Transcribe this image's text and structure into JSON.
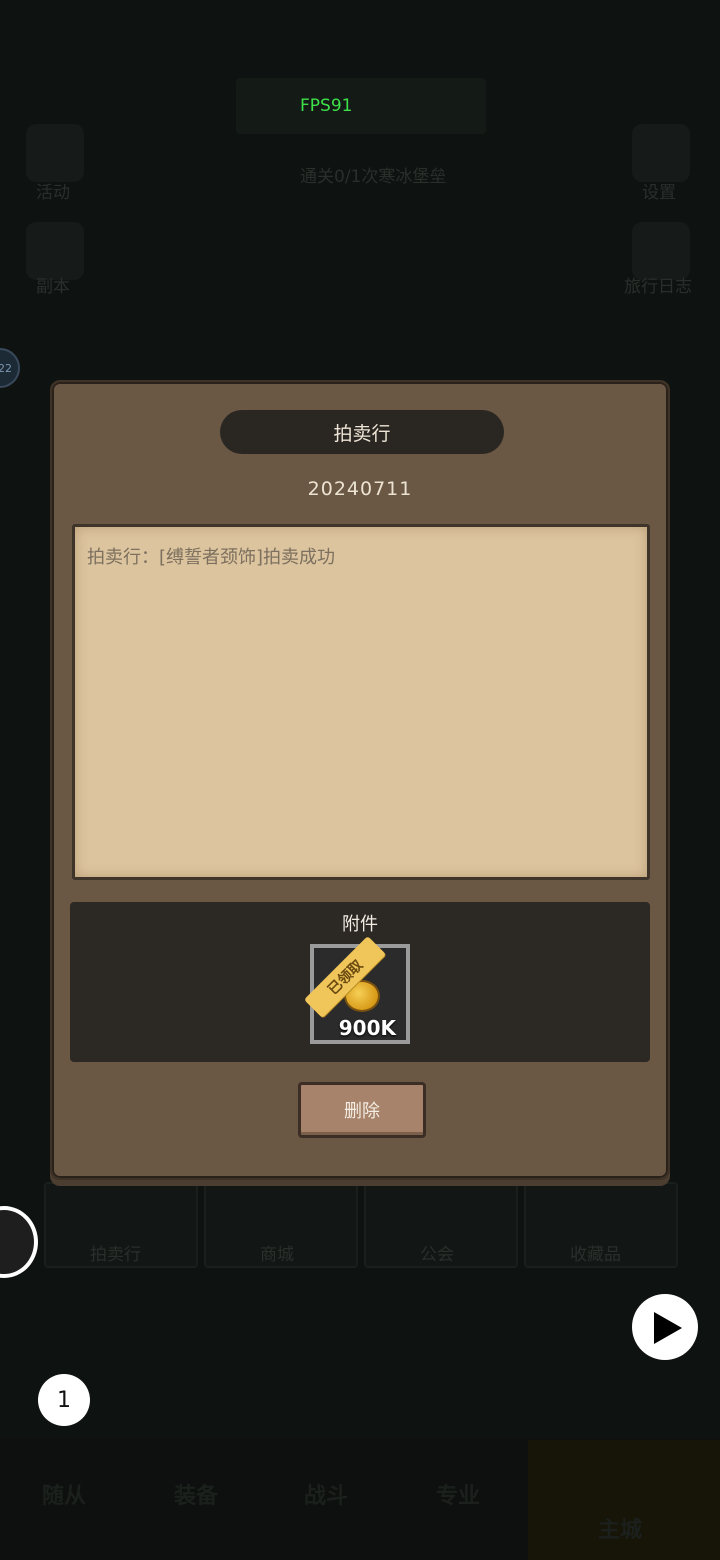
{
  "hud": {
    "fps": "FPS91"
  },
  "background": {
    "left_labels": [
      "活动",
      "副本"
    ],
    "right_labels": [
      "设置",
      "旅行日志"
    ],
    "quest": "通关0/1次寒冰堡垒",
    "tiles": [
      "拍卖行",
      "商城",
      "公会",
      "收藏品"
    ],
    "nav": [
      "随从",
      "装备",
      "战斗",
      "专业",
      "主城"
    ]
  },
  "side_badge": "22",
  "modal": {
    "title": "拍卖行",
    "date": "20240711",
    "letter_text": "拍卖行：[缚誓者颈饰]拍卖成功",
    "attachments_title": "附件",
    "item": {
      "icon": "gold-coin-icon",
      "quantity": "900K",
      "status": "已领取"
    },
    "delete_label": "删除"
  },
  "overlay": {
    "count": "1"
  }
}
